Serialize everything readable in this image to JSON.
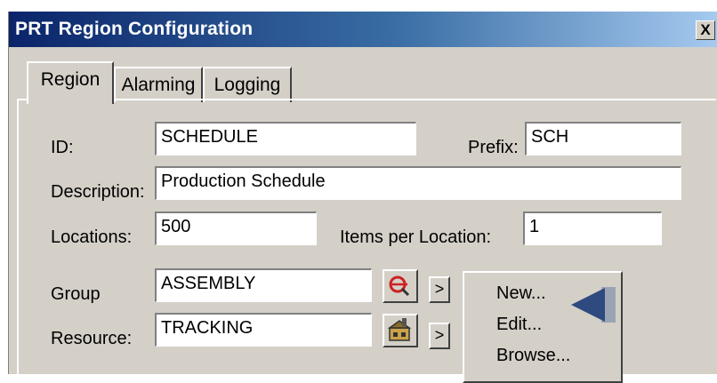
{
  "window": {
    "title": "PRT Region Configuration",
    "close_label": "X"
  },
  "tabs": [
    {
      "label": "Region",
      "active": true
    },
    {
      "label": "Alarming",
      "active": false
    },
    {
      "label": "Logging",
      "active": false
    }
  ],
  "form": {
    "id_label": "ID:",
    "id_value": "SCHEDULE",
    "prefix_label": "Prefix:",
    "prefix_value": "SCH",
    "description_label": "Description:",
    "description_value": "Production Schedule",
    "locations_label": "Locations:",
    "locations_value": "500",
    "items_per_location_label": "Items per Location:",
    "items_per_location_value": "1",
    "group_label": "Group",
    "group_value": "ASSEMBLY",
    "resource_label": "Resource:",
    "resource_value": "TRACKING",
    "more_button_label": ">"
  },
  "context_menu": {
    "items": [
      "New...",
      "Edit...",
      "Browse..."
    ]
  },
  "icons": {
    "group_button": "group-lookup-icon",
    "resource_button": "resource-building-icon",
    "pointer": "pointer-arrow-icon"
  },
  "colors": {
    "title_start": "#0a246a",
    "title_end": "#a6caf0",
    "face": "#d4d0c8",
    "pointer": "#2f4a7f"
  }
}
